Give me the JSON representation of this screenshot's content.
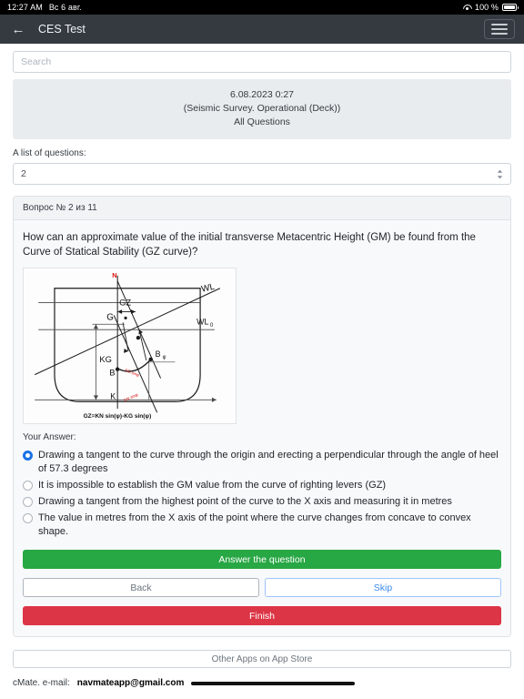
{
  "status_bar": {
    "time": "12:27 AM",
    "date": "Вс 6 авг.",
    "wifi_icon": "wifi-icon",
    "battery_percent": "100 %",
    "battery_icon": "battery-full-icon"
  },
  "navbar": {
    "back_icon": "back-arrow-icon",
    "title": "CES Test",
    "menu_icon": "hamburger-menu-icon"
  },
  "search": {
    "placeholder": "Search",
    "value": ""
  },
  "info_panel": {
    "line1": "6.08.2023 0:27",
    "line2": "(Seismic Survey. Operational (Deck))",
    "line3": "All Questions"
  },
  "question_list": {
    "label": "A list of questions:",
    "selected": "2",
    "stepper_icon": "chevron-up-down-icon"
  },
  "question": {
    "header": "Вопрос № 2 из 11",
    "text": "How can an approximate value of the initial transverse Metacentric Height (GM) be found from the Curve of Statical Stability (GZ curve)?",
    "answer_label": "Your Answer:",
    "options": [
      {
        "label": "Drawing a tangent to the curve through the origin and erecting a perpendicular through the angle of heel of 57.3 degrees",
        "selected": true
      },
      {
        "label": "It is impossible to establish the GM value from the curve of righting levers (GZ)",
        "selected": false
      },
      {
        "label": "Drawing a tangent from the highest point of the curve to the X axis and measuring it in metres",
        "selected": false
      },
      {
        "label": "The value in metres from the X axis of the point where the curve changes from concave to convex shape.",
        "selected": false
      }
    ]
  },
  "figure": {
    "name": "ship-stability-cross-section-diagram",
    "caption": "GZ=KN sin(φ)-KG sin(φ)",
    "labels": {
      "n": "N",
      "gz": "GZ",
      "g": "G",
      "wl": "WL",
      "wl0": "WL",
      "wl0_sub": "0",
      "kg": "KG",
      "b": "B",
      "b_phi": "B",
      "b_phi_sub": "φ",
      "k": "K",
      "red1": "KG sinφ",
      "red2": "KN sinφ"
    }
  },
  "buttons": {
    "answer": "Answer the question",
    "back": "Back",
    "skip": "Skip",
    "finish": "Finish"
  },
  "footer": {
    "other_apps": "Other Apps on App Store",
    "credit_prefix": "cMate. e-mail:",
    "credit_email": "navmateapp@gmail.com",
    "home_indicator": "home-indicator"
  },
  "colors": {
    "navbar_bg": "#343a40",
    "answer_green": "#28a745",
    "finish_red": "#dc3545",
    "skip_blue": "#3b8bf0",
    "radio_blue": "#1a73e8",
    "panel_gray": "#e9ecef"
  }
}
